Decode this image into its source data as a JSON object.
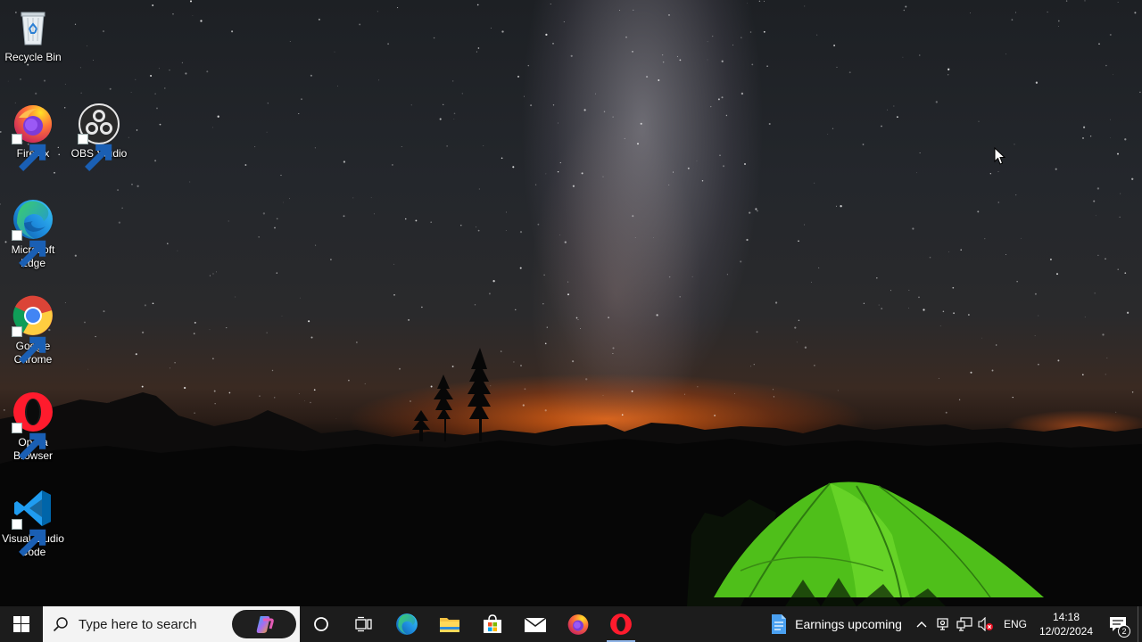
{
  "desktop": {
    "icons": [
      {
        "label": "Recycle Bin",
        "icon": "recycle-bin-icon"
      },
      {
        "label": "Firefox",
        "icon": "firefox-icon"
      },
      {
        "label": "OBS Studio",
        "icon": "obs-studio-icon"
      },
      {
        "label": "Microsoft Edge",
        "icon": "edge-icon"
      },
      {
        "label": "Google Chrome",
        "icon": "chrome-icon"
      },
      {
        "label": "Opera Browser",
        "icon": "opera-icon"
      },
      {
        "label": "Visual Studio Code",
        "icon": "vscode-icon"
      }
    ]
  },
  "taskbar": {
    "search": {
      "placeholder": "Type here to search"
    },
    "pinned": [
      {
        "name": "cortana",
        "icon": "cortana-icon"
      },
      {
        "name": "task-view",
        "icon": "task-view-icon"
      },
      {
        "name": "edge",
        "icon": "edge-icon"
      },
      {
        "name": "file-explorer",
        "icon": "folder-icon"
      },
      {
        "name": "microsoft-store",
        "icon": "store-icon"
      },
      {
        "name": "mail",
        "icon": "mail-icon"
      },
      {
        "name": "firefox",
        "icon": "firefox-icon"
      },
      {
        "name": "opera",
        "icon": "opera-icon",
        "active": true
      }
    ],
    "widget": {
      "text": "Earnings upcoming",
      "icon": "news-doc-icon"
    },
    "tray": {
      "language": "ENG",
      "time": "14:18",
      "date": "12/02/2024",
      "notification_count": "2"
    }
  },
  "colors": {
    "taskbar_bg": "#1c1c1c",
    "search_bg": "#f3f3f3",
    "active_indicator": "#8fb4e6"
  }
}
